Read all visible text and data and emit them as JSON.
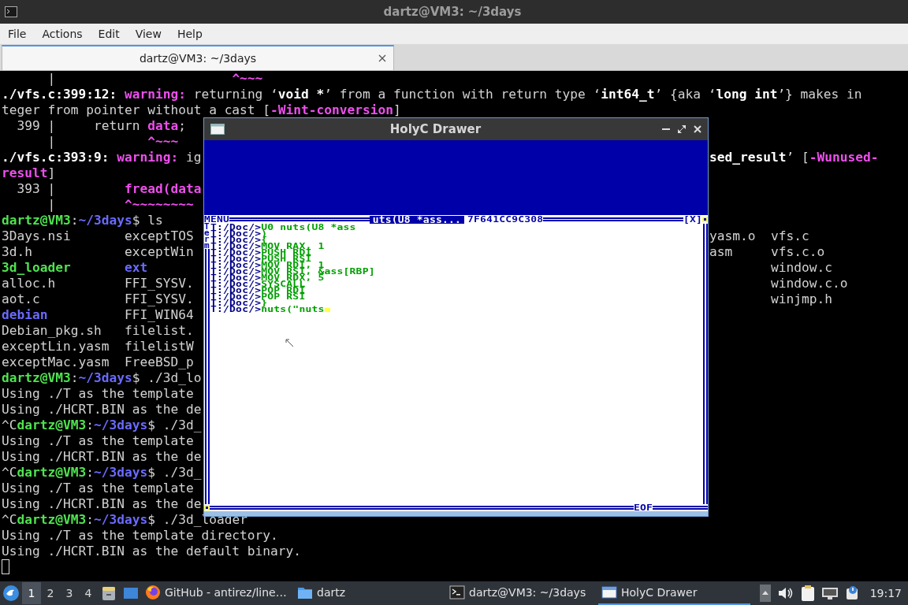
{
  "terminal_window": {
    "title": "dartz@VM3: ~/3days",
    "menu": [
      "File",
      "Actions",
      "Edit",
      "View",
      "Help"
    ],
    "tabs": [
      {
        "label": "dartz@VM3: ~/3days",
        "selected": true
      }
    ],
    "lines": [
      {
        "left": [
          {
            "text": "      |                       ",
            "kind": "plain"
          },
          {
            "text": "^~~~",
            "kind": "warn"
          }
        ]
      },
      {
        "left": [
          {
            "text": "./vfs.c:399:12: ",
            "kind": "bold"
          },
          {
            "text": "warning: ",
            "kind": "warn"
          },
          {
            "text": "returning ‘",
            "kind": "plain"
          },
          {
            "text": "void *",
            "kind": "bold"
          },
          {
            "text": "’ from a function with return type ‘",
            "kind": "plain"
          },
          {
            "text": "int64_t",
            "kind": "bold"
          },
          {
            "text": "’ {aka ‘",
            "kind": "plain"
          },
          {
            "text": "long int",
            "kind": "bold"
          },
          {
            "text": "’} makes in",
            "kind": "plain"
          }
        ]
      },
      {
        "left": [
          {
            "text": "teger from pointer without a cast [",
            "kind": "plain"
          },
          {
            "text": "-Wint-conversion",
            "kind": "warn"
          },
          {
            "text": "]",
            "kind": "plain"
          }
        ]
      },
      {
        "left": [
          {
            "text": "  399 |     return ",
            "kind": "plain"
          },
          {
            "text": "data",
            "kind": "warn"
          },
          {
            "text": ";",
            "kind": "plain"
          }
        ]
      },
      {
        "left": [
          {
            "text": "      |            ",
            "kind": "plain"
          },
          {
            "text": "^~~~",
            "kind": "warn"
          }
        ]
      },
      {
        "left": [
          {
            "text": "./vfs.c:393:9: ",
            "kind": "bold"
          },
          {
            "text": "warning: ",
            "kind": "warn"
          },
          {
            "text": "ig",
            "kind": "plain"
          }
        ],
        "right": [
          {
            "text": "sed_result",
            "kind": "bold"
          },
          {
            "text": "’ [",
            "kind": "plain"
          },
          {
            "text": "-Wunused-",
            "kind": "warn"
          }
        ]
      },
      {
        "left": [
          {
            "text": "result",
            "kind": "warn"
          },
          {
            "text": "]",
            "kind": "plain"
          }
        ]
      },
      {
        "left": [
          {
            "text": "  393 |         ",
            "kind": "plain"
          },
          {
            "text": "fread(data",
            "kind": "warn"
          }
        ]
      },
      {
        "left": [
          {
            "text": "      |         ",
            "kind": "plain"
          },
          {
            "text": "^~~~~~~~~",
            "kind": "warn"
          }
        ]
      },
      {
        "left": [
          {
            "text": "dartz@VM3",
            "kind": "user"
          },
          {
            "text": ":",
            "kind": "plain"
          },
          {
            "text": "~/3days",
            "kind": "path"
          },
          {
            "text": "$ ls",
            "kind": "plain"
          }
        ]
      },
      {
        "left": [
          {
            "text": "3Days.nsi       exceptTOS",
            "kind": "plain"
          }
        ],
        "right": [
          {
            "text": "yasm.o  vfs.c",
            "kind": "plain"
          }
        ]
      },
      {
        "left": [
          {
            "text": "3d.h            exceptWin",
            "kind": "plain"
          }
        ],
        "right": [
          {
            "text": "asm     vfs.c.o",
            "kind": "plain"
          }
        ]
      },
      {
        "left": [
          {
            "text": "3d_loader       ",
            "kind": "exec"
          },
          {
            "text": "ext",
            "kind": "dir"
          }
        ],
        "right": [
          {
            "text": "        window.c",
            "kind": "plain"
          }
        ]
      },
      {
        "left": [
          {
            "text": "alloc.h         FFI_SYSV.",
            "kind": "plain"
          }
        ],
        "right": [
          {
            "text": "        window.c.o",
            "kind": "plain"
          }
        ]
      },
      {
        "left": [
          {
            "text": "aot.c           FFI_SYSV.",
            "kind": "plain"
          }
        ],
        "right": [
          {
            "text": "        winjmp.h",
            "kind": "plain"
          }
        ]
      },
      {
        "left": [
          {
            "text": "debian",
            "kind": "dir"
          },
          {
            "text": "          FFI_WIN64",
            "kind": "plain"
          }
        ]
      },
      {
        "left": [
          {
            "text": "Debian_pkg.sh   filelist.",
            "kind": "plain"
          }
        ]
      },
      {
        "left": [
          {
            "text": "exceptLin.yasm  filelistW",
            "kind": "plain"
          }
        ]
      },
      {
        "left": [
          {
            "text": "exceptMac.yasm  FreeBSD_p",
            "kind": "plain"
          }
        ]
      },
      {
        "left": [
          {
            "text": "dartz@VM3",
            "kind": "user"
          },
          {
            "text": ":",
            "kind": "plain"
          },
          {
            "text": "~/3days",
            "kind": "path"
          },
          {
            "text": "$ ./3d_lo",
            "kind": "plain"
          }
        ]
      },
      {
        "left": [
          {
            "text": "Using ./T as the template",
            "kind": "plain"
          }
        ]
      },
      {
        "left": [
          {
            "text": "Using ./HCRT.BIN as the de",
            "kind": "plain"
          }
        ]
      },
      {
        "left": [
          {
            "text": "^C",
            "kind": "plain"
          },
          {
            "text": "dartz@VM3",
            "kind": "user"
          },
          {
            "text": ":",
            "kind": "plain"
          },
          {
            "text": "~/3days",
            "kind": "path"
          },
          {
            "text": "$ ./3d_",
            "kind": "plain"
          }
        ]
      },
      {
        "left": [
          {
            "text": "Using ./T as the template",
            "kind": "plain"
          }
        ]
      },
      {
        "left": [
          {
            "text": "Using ./HCRT.BIN as the de",
            "kind": "plain"
          }
        ]
      },
      {
        "left": [
          {
            "text": "^C",
            "kind": "plain"
          },
          {
            "text": "dartz@VM3",
            "kind": "user"
          },
          {
            "text": ":",
            "kind": "plain"
          },
          {
            "text": "~/3days",
            "kind": "path"
          },
          {
            "text": "$ ./3d_",
            "kind": "plain"
          }
        ]
      },
      {
        "left": [
          {
            "text": "Using ./T as the template",
            "kind": "plain"
          }
        ]
      },
      {
        "left": [
          {
            "text": "Using ./HCRT.BIN as the de",
            "kind": "plain"
          }
        ]
      },
      {
        "left": [
          {
            "text": "^C",
            "kind": "plain"
          },
          {
            "text": "dartz@VM3",
            "kind": "user"
          },
          {
            "text": ":",
            "kind": "plain"
          },
          {
            "text": "~/3days",
            "kind": "path"
          },
          {
            "text": "$ ./3d_loader",
            "kind": "plain"
          }
        ]
      },
      {
        "left": [
          {
            "text": "Using ./T as the template directory.",
            "kind": "plain"
          }
        ]
      },
      {
        "left": [
          {
            "text": "Using ./HCRT.BIN as the default binary.",
            "kind": "plain"
          }
        ]
      }
    ]
  },
  "holyc_window": {
    "title": "HolyC Drawer",
    "document": {
      "menu_label": "MENU",
      "doc_title": "uts(U8 *ass...",
      "address": "7F641CC9C308",
      "close_label": "[X]",
      "side_label": "Term",
      "footer": "EOF",
      "lines": [
        {
          "prompt": "T:/Doc/>",
          "code": "U0 nuts(U8 *ass",
          "cursor": false
        },
        {
          "prompt": "T:/Doc/>",
          "code": ")",
          "cursor": false
        },
        {
          "prompt": "T:/Doc/>",
          "code": "{",
          "cursor": false
        },
        {
          "prompt": "T:/Doc/>",
          "code": "MOV RAX, 1",
          "cursor": false
        },
        {
          "prompt": "T:/Doc/>",
          "code": "PUSH RDI",
          "cursor": false
        },
        {
          "prompt": "T:/Doc/>",
          "code": "PUSH RSI",
          "cursor": false
        },
        {
          "prompt": "T:/Doc/>",
          "code": "MOV RDI, 1",
          "cursor": false
        },
        {
          "prompt": "T:/Doc/>",
          "code": "MOV RSI, &ass[RBP]",
          "cursor": false
        },
        {
          "prompt": "T:/Doc/>",
          "code": "MOV RDX, 5",
          "cursor": false
        },
        {
          "prompt": "T:/Doc/>",
          "code": "SYSCALL",
          "cursor": false
        },
        {
          "prompt": "T:/Doc/>",
          "code": "POP RDI",
          "cursor": false
        },
        {
          "prompt": "T:/Doc/>",
          "code": "POP RSI",
          "cursor": false
        },
        {
          "prompt": "T:/Doc/>",
          "code": "}",
          "cursor": false
        },
        {
          "prompt": "T:/Doc/>",
          "code": "nuts(\"nuts",
          "cursor": true
        }
      ]
    }
  },
  "taskbar": {
    "workspaces": [
      {
        "label": "1",
        "selected": true
      },
      {
        "label": "2",
        "selected": false
      },
      {
        "label": "3",
        "selected": false
      },
      {
        "label": "4",
        "selected": false
      }
    ],
    "tasks": [
      {
        "label": "GitHub - antirez/line…",
        "kind": "browser",
        "selected": false
      },
      {
        "label": "dartz",
        "kind": "folder",
        "selected": false
      },
      {
        "label": "dartz@VM3: ~/3days",
        "kind": "terminal",
        "selected": false
      },
      {
        "label": "HolyC Drawer",
        "kind": "window",
        "selected": true
      }
    ],
    "clock": "19:17"
  }
}
